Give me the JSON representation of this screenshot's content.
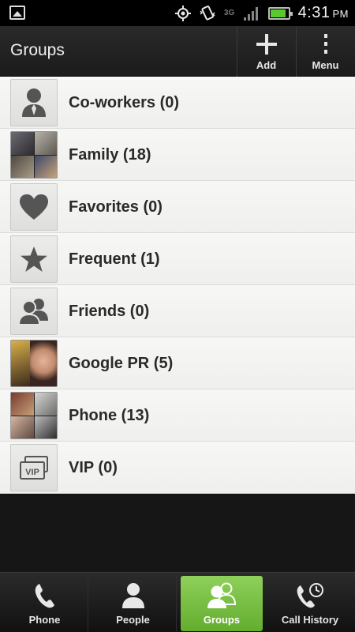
{
  "status_bar": {
    "network": "3G",
    "time": "4:31",
    "ampm": "PM",
    "battery_level": 0.9,
    "battery_color": "#5ac92b"
  },
  "action_bar": {
    "title": "Groups",
    "add_label": "Add",
    "menu_label": "Menu"
  },
  "groups": [
    {
      "label": "Co-workers (0)",
      "icon": "person-icon"
    },
    {
      "label": "Family (18)",
      "icon": "photo-mosaic"
    },
    {
      "label": "Favorites (0)",
      "icon": "heart-icon"
    },
    {
      "label": "Frequent (1)",
      "icon": "star-icon"
    },
    {
      "label": "Friends (0)",
      "icon": "people-icon"
    },
    {
      "label": "Google PR (5)",
      "icon": "photo-mosaic"
    },
    {
      "label": "Phone (13)",
      "icon": "photo-mosaic"
    },
    {
      "label": "VIP (0)",
      "icon": "vip-cards-icon"
    }
  ],
  "tabs": {
    "phone": "Phone",
    "people": "People",
    "groups": "Groups",
    "call_history": "Call History",
    "active": "groups",
    "active_color": "#7cc242"
  }
}
